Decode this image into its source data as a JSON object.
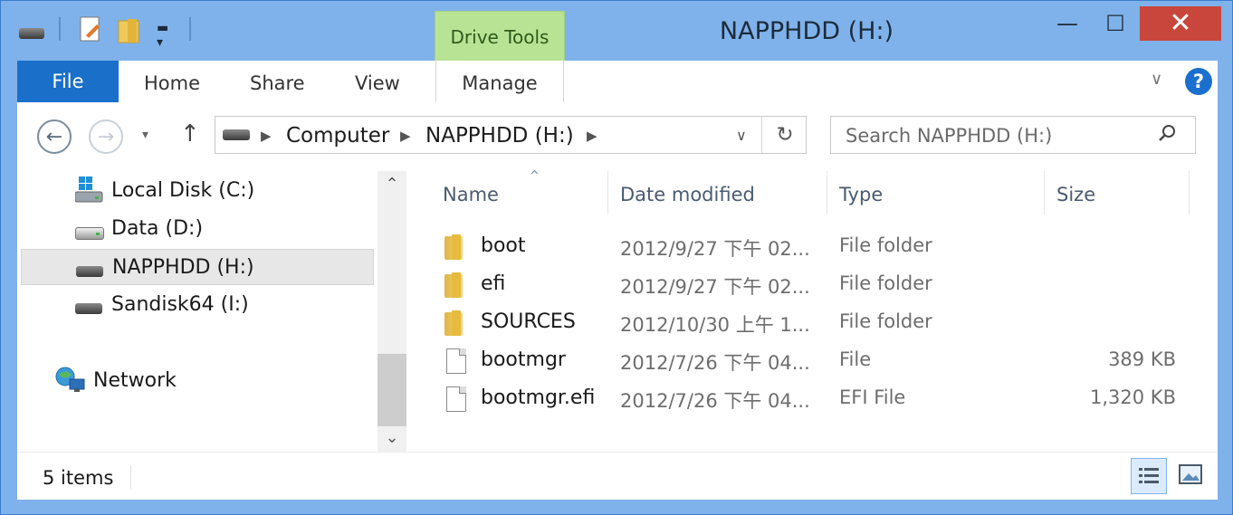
{
  "window": {
    "title": "NAPPHDD (H:)",
    "contextual_tab": "Drive Tools",
    "controls": {
      "minimize": "—",
      "maximize": "☐",
      "close": "✕"
    }
  },
  "quick_access": {
    "icons": [
      "drive-icon",
      "properties-icon",
      "new-folder-icon",
      "customize-dropdown-icon"
    ]
  },
  "ribbon": {
    "file_label": "File",
    "tabs": [
      "Home",
      "Share",
      "View"
    ],
    "manage_label": "Manage",
    "help_glyph": "?",
    "collapse_glyph": "∨"
  },
  "navigation": {
    "back_glyph": "←",
    "forward_glyph": "→",
    "recent_glyph": "▾",
    "up_glyph": "↑",
    "breadcrumb": [
      "Computer",
      "NAPPHDD (H:)"
    ],
    "refresh_glyph": "↻",
    "search_placeholder": "Search NAPPHDD (H:)"
  },
  "nav_pane": {
    "items": [
      {
        "label": "Local Disk (C:)",
        "icon": "windows-drive-icon"
      },
      {
        "label": "Data (D:)",
        "icon": "hard-drive-icon"
      },
      {
        "label": "NAPPHDD (H:)",
        "icon": "removable-drive-icon",
        "selected": true
      },
      {
        "label": "Sandisk64 (I:)",
        "icon": "removable-drive-icon"
      }
    ],
    "network_label": "Network"
  },
  "columns": {
    "name": "Name",
    "date": "Date modified",
    "type": "Type",
    "size": "Size"
  },
  "files": [
    {
      "name": "boot",
      "date": "2012/9/27 下午 02...",
      "type": "File folder",
      "size": "",
      "icon": "folder-icon"
    },
    {
      "name": "efi",
      "date": "2012/9/27 下午 02...",
      "type": "File folder",
      "size": "",
      "icon": "folder-icon"
    },
    {
      "name": "SOURCES",
      "date": "2012/10/30 上午 1...",
      "type": "File folder",
      "size": "",
      "icon": "folder-icon"
    },
    {
      "name": "bootmgr",
      "date": "2012/7/26 下午 04...",
      "type": "File",
      "size": "389 KB",
      "icon": "file-icon"
    },
    {
      "name": "bootmgr.efi",
      "date": "2012/7/26 下午 04...",
      "type": "EFI File",
      "size": "1,320 KB",
      "icon": "file-icon"
    }
  ],
  "status": {
    "item_count": "5 items"
  },
  "colors": {
    "title_bar": "#7fb2ea",
    "file_tab": "#1a6fc8",
    "contextual_tab": "#b9e394",
    "close_button": "#c9463c",
    "selection": "#e7e7e7"
  }
}
